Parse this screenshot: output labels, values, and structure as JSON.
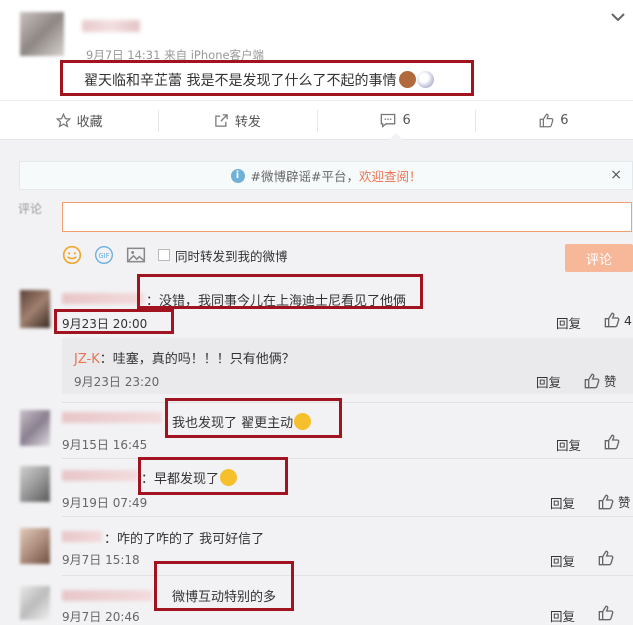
{
  "post": {
    "meta": "9月7日 14:31 来自 iPhone客户端",
    "text": "翟天临和辛芷蕾 我是不是发现了什么了不起的事情"
  },
  "actions": [
    {
      "label": "收藏",
      "icon": "star-icon"
    },
    {
      "label": "转发",
      "icon": "share-icon"
    },
    {
      "label": "6",
      "icon": "comment-icon"
    },
    {
      "label": "6",
      "icon": "thumbs-up-icon"
    }
  ],
  "notice": {
    "prefix": "#微博辟谣#平台，",
    "highlight": "欢迎查阅！",
    "close": "×"
  },
  "composer": {
    "label": "评论",
    "checkbox_label": "同时转发到我的微博",
    "submit": "评论",
    "gif": "GIF"
  },
  "comments": [
    {
      "text": "：没错，我同事今儿在上海迪士尼看见了他俩",
      "time": "9月23日 20:00",
      "reply": "回复",
      "like": "4"
    },
    {
      "text": "我也发现了 翟更主动",
      "time": "9月15日 16:45",
      "reply": "回复",
      "like": ""
    },
    {
      "text": "：早都发现了",
      "time": "9月19日 07:49",
      "reply": "回复",
      "like": "赞"
    },
    {
      "text": "：咋的了咋的了 我可好信了",
      "time": "9月7日 15:18",
      "reply": "回复",
      "like": ""
    },
    {
      "text": "微博互动特别的多",
      "time": "9月7日 20:46",
      "reply": "回复",
      "like": ""
    }
  ],
  "subreply": {
    "name": "JZ-K",
    "text": "：哇塞，真的吗！！！只有他俩？",
    "time": "9月23日 23:20",
    "reply": "回复",
    "like": "赞"
  },
  "colors": {
    "highlight_box": "#a0131f",
    "accent": "#eb7350"
  }
}
